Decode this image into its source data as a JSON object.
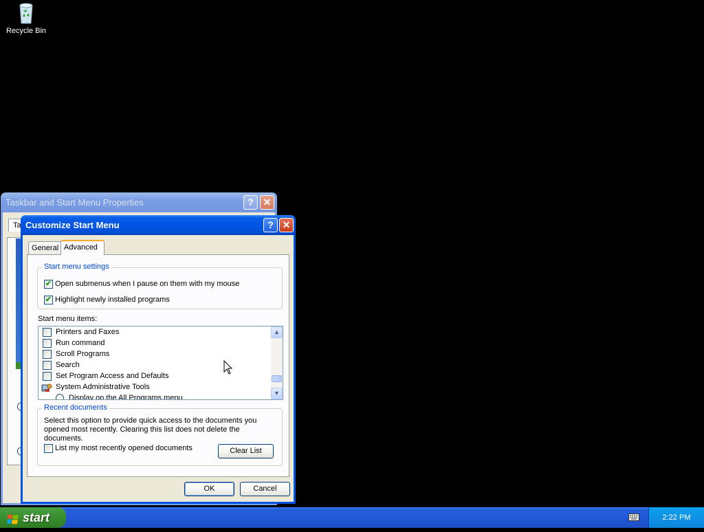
{
  "desktop": {
    "icons": [
      {
        "label": "Recycle Bin",
        "icon": "recycle-bin-icon"
      }
    ]
  },
  "background_window": {
    "title": "Taskbar and Start Menu Properties",
    "tab_visible": "Ta"
  },
  "dialog": {
    "title": "Customize Start Menu",
    "tabs": [
      {
        "label": "General",
        "selected": false
      },
      {
        "label": "Advanced",
        "selected": true
      }
    ],
    "start_menu_settings": {
      "title": "Start menu settings",
      "options": [
        {
          "label": "Open submenus when I pause on them with my mouse",
          "checked": true
        },
        {
          "label": "Highlight newly installed programs",
          "checked": true
        }
      ]
    },
    "start_menu_items": {
      "label": "Start menu items:",
      "items": [
        {
          "label": "Printers and Faxes",
          "type": "checkbox",
          "checked": false
        },
        {
          "label": "Run command",
          "type": "checkbox",
          "checked": false
        },
        {
          "label": "Scroll Programs",
          "type": "checkbox",
          "checked": false
        },
        {
          "label": "Search",
          "type": "checkbox",
          "checked": false
        },
        {
          "label": "Set Program Access and Defaults",
          "type": "checkbox",
          "checked": false
        },
        {
          "label": "System Administrative Tools",
          "type": "header",
          "icon": "admin-tools-icon"
        },
        {
          "label": "Display on the All Programs menu",
          "type": "radio",
          "checked": false
        }
      ]
    },
    "recent_documents": {
      "title": "Recent documents",
      "description": "Select this option to provide quick access to the documents you opened most recently.  Clearing this list does not delete the documents.",
      "option_label": "List my most recently opened documents",
      "option_checked": false,
      "clear_button": "Clear List"
    },
    "ok_button": "OK",
    "cancel_button": "Cancel"
  },
  "taskbar": {
    "start_label": "start",
    "clock": "2:22 PM",
    "tray_icon": "keyboard-icon"
  },
  "colors": {
    "title_active": "#0054e3",
    "group_title": "#0046d5",
    "start_green": "#3b9231",
    "taskbar_blue": "#245edb"
  }
}
